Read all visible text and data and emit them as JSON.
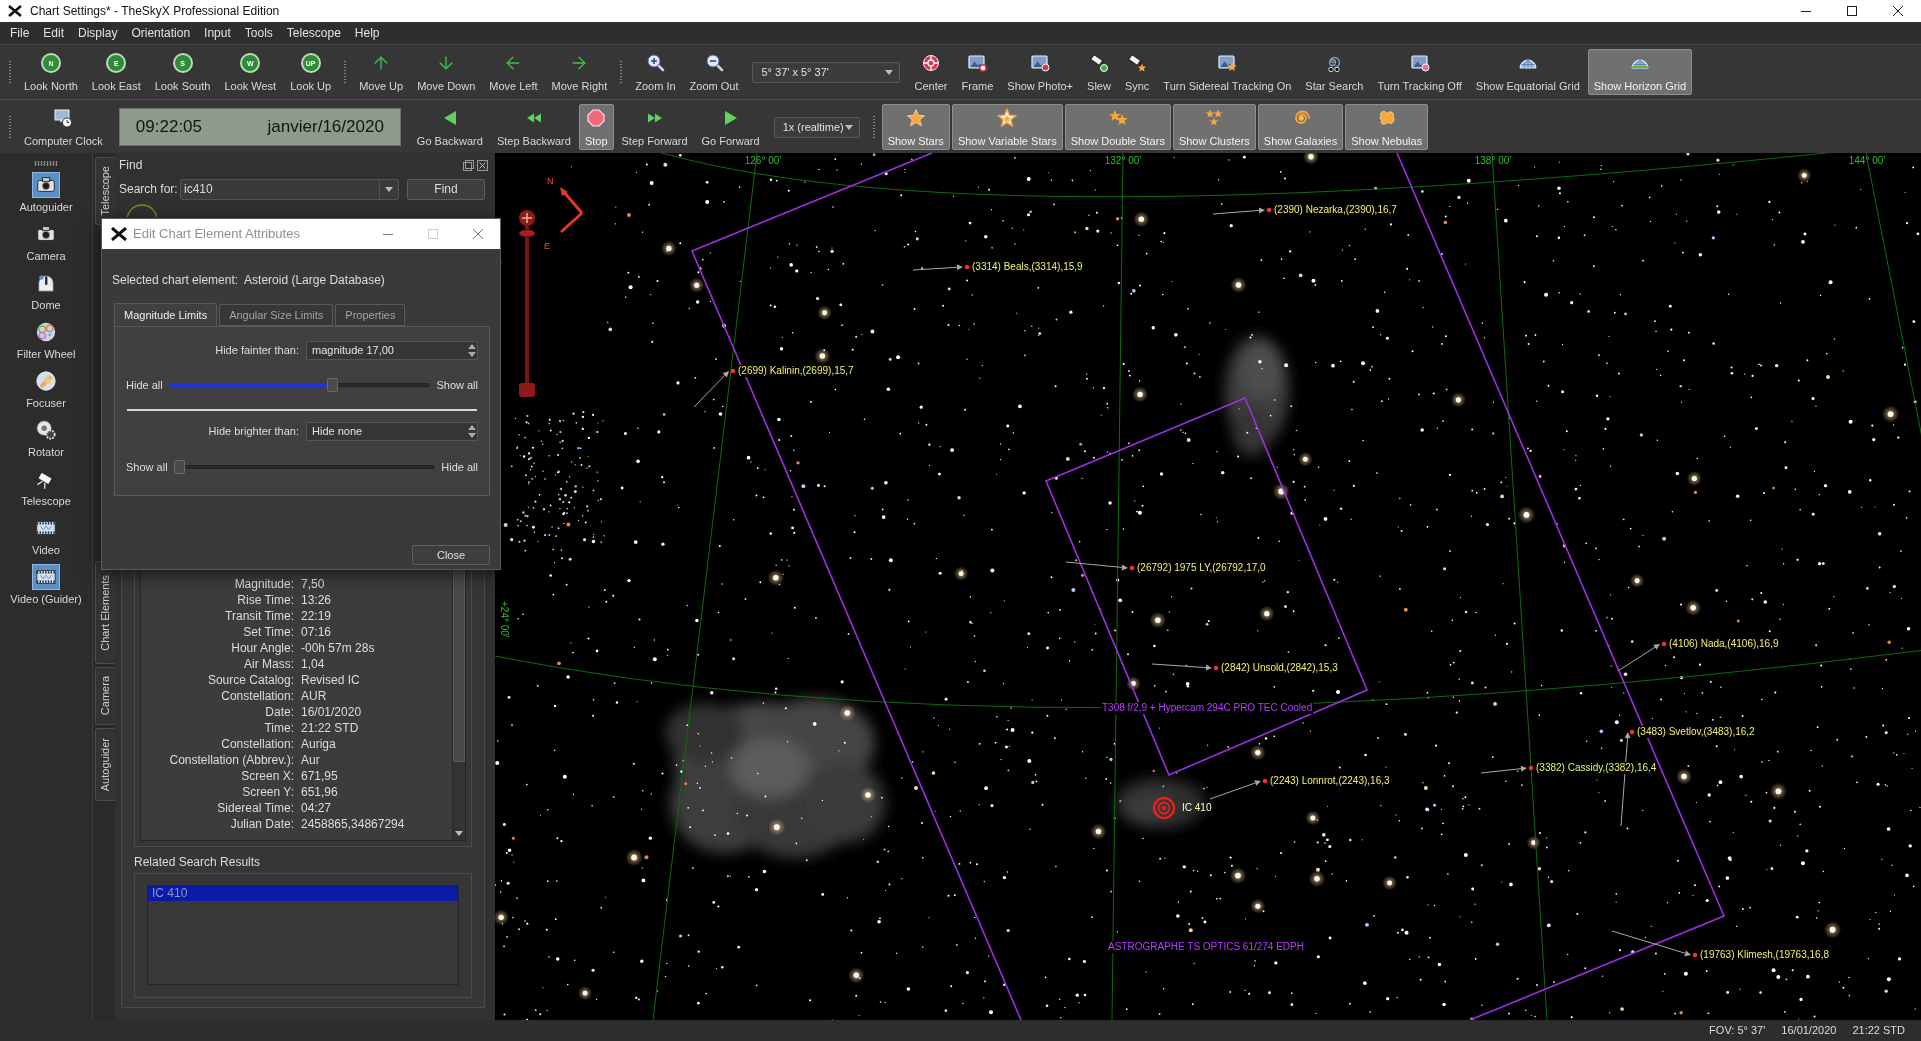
{
  "window": {
    "title": "Chart Settings* - TheSkyX Professional Edition"
  },
  "menu": [
    "File",
    "Edit",
    "Display",
    "Orientation",
    "Input",
    "Tools",
    "Telescope",
    "Help"
  ],
  "toolbar_top": [
    {
      "kind": "grip"
    },
    {
      "kind": "look",
      "label": "Look North",
      "glyph": "N",
      "selected": false
    },
    {
      "kind": "look",
      "label": "Look East",
      "glyph": "E",
      "selected": false
    },
    {
      "kind": "look",
      "label": "Look South",
      "glyph": "S",
      "selected": false
    },
    {
      "kind": "look",
      "label": "Look West",
      "glyph": "W",
      "selected": false
    },
    {
      "kind": "look",
      "label": "Look Up",
      "glyph": "UP",
      "selected": false
    },
    {
      "kind": "grip"
    },
    {
      "kind": "button",
      "label": "Move Up",
      "selected": false
    },
    {
      "kind": "button",
      "label": "Move Down",
      "selected": false
    },
    {
      "kind": "button",
      "label": "Move Left",
      "selected": false
    },
    {
      "kind": "button",
      "label": "Move Right",
      "selected": false
    },
    {
      "kind": "grip"
    },
    {
      "kind": "button",
      "label": "Zoom In",
      "selected": false
    },
    {
      "kind": "button",
      "label": "Zoom Out",
      "selected": false
    },
    {
      "kind": "combo",
      "value": "5° 37' x 5° 37'"
    },
    {
      "kind": "button",
      "label": "Center",
      "selected": false
    },
    {
      "kind": "button",
      "label": "Frame",
      "selected": false
    },
    {
      "kind": "button",
      "label": "Show Photo+",
      "selected": false
    },
    {
      "kind": "button",
      "label": "Slew",
      "selected": false
    },
    {
      "kind": "button",
      "label": "Sync",
      "selected": false
    },
    {
      "kind": "button",
      "label": "Turn Sidereal Tracking On",
      "selected": false
    },
    {
      "kind": "button",
      "label": "Star Search",
      "selected": false
    },
    {
      "kind": "button",
      "label": "Turn Tracking Off",
      "selected": false
    },
    {
      "kind": "button",
      "label": "Show Equatorial Grid",
      "selected": false
    },
    {
      "kind": "button",
      "label": "Show Horizon Grid",
      "selected": true
    }
  ],
  "toolbar_bottom": [
    {
      "kind": "grip"
    },
    {
      "kind": "button",
      "label": "Computer Clock",
      "selected": false
    },
    {
      "kind": "clock",
      "time": "09:22:05",
      "date": "janvier/16/2020"
    },
    {
      "kind": "button",
      "label": "Go Backward",
      "selected": false
    },
    {
      "kind": "button",
      "label": "Step Backward",
      "selected": false
    },
    {
      "kind": "button",
      "label": "Stop",
      "selected": true
    },
    {
      "kind": "button",
      "label": "Step Forward",
      "selected": false
    },
    {
      "kind": "button",
      "label": "Go Forward",
      "selected": false
    },
    {
      "kind": "combo",
      "value": "1x (realtime)"
    },
    {
      "kind": "grip"
    },
    {
      "kind": "button",
      "label": "Show Stars",
      "selected": true
    },
    {
      "kind": "button",
      "label": "Show Variable Stars",
      "selected": true
    },
    {
      "kind": "button",
      "label": "Show Double Stars",
      "selected": true
    },
    {
      "kind": "button",
      "label": "Show Clusters",
      "selected": true
    },
    {
      "kind": "button",
      "label": "Show Galaxies",
      "selected": true
    },
    {
      "kind": "button",
      "label": "Show Nebulas",
      "selected": true
    }
  ],
  "sidebar": {
    "items": [
      {
        "label": "Autoguider",
        "active": true
      },
      {
        "label": "Camera",
        "active": false
      },
      {
        "label": "Dome",
        "active": false
      },
      {
        "label": "Filter Wheel",
        "active": false
      },
      {
        "label": "Focuser",
        "active": false
      },
      {
        "label": "Rotator",
        "active": false
      },
      {
        "label": "Telescope",
        "active": false
      },
      {
        "label": "Video",
        "active": false
      },
      {
        "label": "Video (Guider)",
        "active": true
      }
    ]
  },
  "side_tabs": [
    {
      "label": "Telescope"
    },
    {
      "label": "Chart Elements"
    },
    {
      "label": "Camera"
    },
    {
      "label": "Autoguider"
    }
  ],
  "find_panel": {
    "title": "Find",
    "search_label": "Search for:",
    "search_value": "ic410",
    "find_button": "Find",
    "details": [
      {
        "label": "Magnitude:",
        "value": "7,50"
      },
      {
        "label": "Rise Time:",
        "value": "13:26"
      },
      {
        "label": "Transit Time:",
        "value": "22:19"
      },
      {
        "label": "Set Time:",
        "value": "07:16"
      },
      {
        "label": "Hour Angle:",
        "value": "-00h 57m 28s"
      },
      {
        "label": "Air Mass:",
        "value": "1,04"
      },
      {
        "label": "Source Catalog:",
        "value": "Revised IC"
      },
      {
        "label": "Constellation:",
        "value": "AUR"
      },
      {
        "label": "Date:",
        "value": "16/01/2020"
      },
      {
        "label": "Time:",
        "value": "21:22 STD"
      },
      {
        "label": "Constellation:",
        "value": "Auriga"
      },
      {
        "label": "Constellation (Abbrev.):",
        "value": "Aur"
      },
      {
        "label": "Screen X:",
        "value": "671,95"
      },
      {
        "label": "Screen Y:",
        "value": "651,96"
      },
      {
        "label": "Sidereal Time:",
        "value": "04:27"
      },
      {
        "label": "Julian Date:",
        "value": "2458865,34867294"
      }
    ],
    "related_title": "Related Search Results",
    "related_results": [
      {
        "label": "IC 410",
        "selected": true
      }
    ]
  },
  "dialog": {
    "title": "Edit Chart Element Attributes",
    "selected_element": "Selected chart element:  Asteroid (Large Database)",
    "tabs": [
      {
        "label": "Magnitude Limits",
        "selected": true
      },
      {
        "label": "Angular Size Limits",
        "selected": false
      },
      {
        "label": "Properties",
        "selected": false
      }
    ],
    "limits": [
      {
        "label": "Hide fainter than:",
        "value": "magnitude 17,00",
        "slider": {
          "left": "Hide all",
          "right": "Show all",
          "level": 0.63
        }
      },
      {
        "label": "Hide brighter than:",
        "value": "Hide none",
        "slider": {
          "left": "Show all",
          "right": "Hide all",
          "level": 0
        }
      }
    ],
    "close_button": "Close"
  },
  "chart": {
    "compass": {
      "north": "N",
      "east": "E"
    },
    "vertical_slider": {
      "level": 0.96
    },
    "grid_labels": [
      "126° 00'",
      "132° 00'",
      "138° 00'",
      "144° 00'"
    ],
    "declination_label": "+24° 00'",
    "fov_labels": [
      "T308 f/2,9 + Hypercam 294C PRO TEC Cooled",
      "ASTROGRAPHE TS OPTICS 61/274 EDPH"
    ],
    "target": {
      "label": "IC 410"
    },
    "asteroids": [
      {
        "label": "(2390) Nezarka,(2390),16,7"
      },
      {
        "label": "(3314) Beals,(3314),15,9"
      },
      {
        "label": "(2699) Kalinin,(2699),15,7"
      },
      {
        "label": "(26792) 1975 LY,(26792,17,0"
      },
      {
        "label": "(2842) Unsold,(2842),15,3"
      },
      {
        "label": "(4106) Nada,(4106),16,9"
      },
      {
        "label": "(3483) Svetlov,(3483),16,2"
      },
      {
        "label": "(3382) Cassidy,(3382),16,4"
      },
      {
        "label": "(2243) Lonnrot,(2243),16,3"
      },
      {
        "label": "(19763) Klimesh,(19763,16,8"
      }
    ]
  },
  "status_bar": [
    "FOV: 5° 37'",
    "16/01/2020",
    "21:22 STD"
  ]
}
